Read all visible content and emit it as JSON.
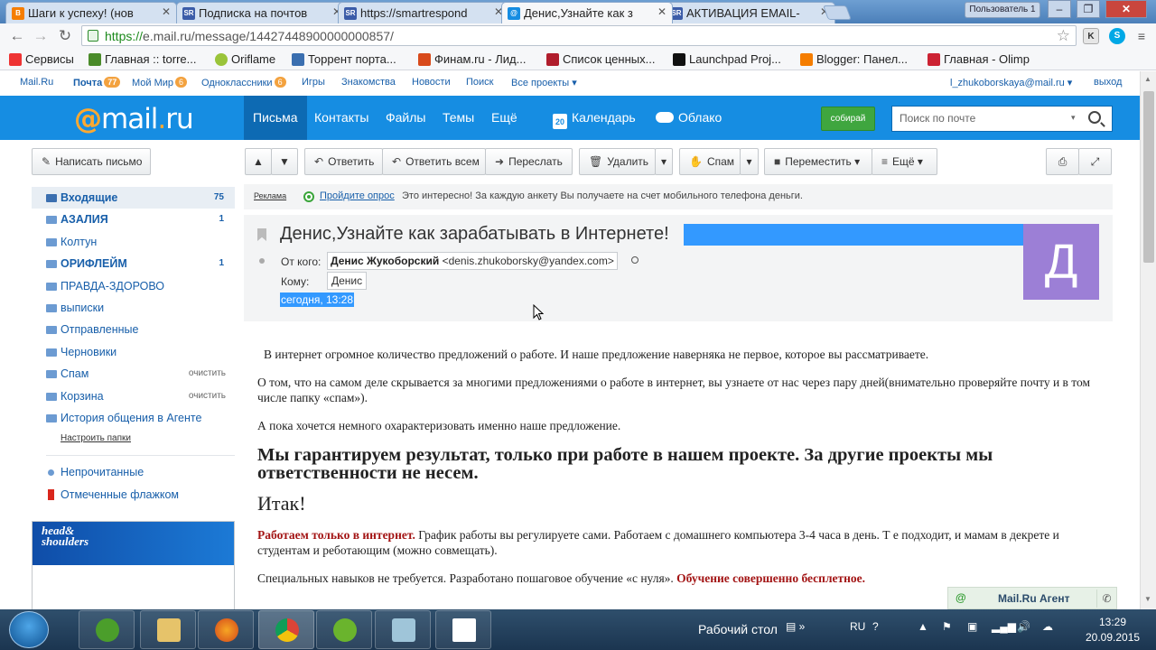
{
  "browser": {
    "tabs": [
      {
        "title": "Шаги к успеху! (нов",
        "favicon": "Blogger",
        "favicon_color": "#f57d00"
      },
      {
        "title": "Подписка на почтов",
        "favicon": "SR",
        "favicon_color": "#3b5ca8"
      },
      {
        "title": "https://smartrespond",
        "favicon": "SR",
        "favicon_color": "#3b5ca8"
      },
      {
        "title": "Денис,Узнайте как з",
        "favicon": "mail",
        "favicon_color": "#168de2"
      },
      {
        "title": "АКТИВАЦИЯ EMAIL-",
        "favicon": "SR",
        "favicon_color": "#3b5ca8"
      }
    ],
    "user_badge": "Пользователь 1",
    "url_secure": "https://",
    "url_rest": "e.mail.ru/message/14427448900000000857/",
    "bookmarks": [
      {
        "label": "Сервисы",
        "color": "#e33"
      },
      {
        "label": "Главная :: torre...",
        "color": "#4a8b2a"
      },
      {
        "label": "Oriflame",
        "color": "#9ac43a"
      },
      {
        "label": "Торрент порта...",
        "color": "#3b6fb0"
      },
      {
        "label": "Финам.ru - Лид...",
        "color": "#d84a1b"
      },
      {
        "label": "Список ценных...",
        "color": "#b01d2c"
      },
      {
        "label": "Launchpad Proj...",
        "color": "#111"
      },
      {
        "label": "Blogger: Панел...",
        "color": "#f57d00"
      },
      {
        "label": "Главная - Olimp",
        "color": "#c23"
      }
    ]
  },
  "portal": {
    "links": [
      "Mail.Ru",
      "Почта",
      "Мой Мир",
      "Одноклассники",
      "Игры",
      "Знакомства",
      "Новости",
      "Поиск",
      "Все проекты"
    ],
    "badges": {
      "mail": "77",
      "mymir": "6",
      "ok": "6"
    },
    "user": "l_zhukoborskaya@mail.ru",
    "logout": "выход"
  },
  "header": {
    "logo_at": "@",
    "logo_mail": "mail",
    "logo_dot": ".",
    "logo_ru": "ru",
    "nav": [
      "Письма",
      "Контакты",
      "Файлы",
      "Темы",
      "Ещё"
    ],
    "calendar": "Календарь",
    "calendar_day": "20",
    "cloud": "Облако",
    "collect": "собирай",
    "search_placeholder": "Поиск по почте"
  },
  "toolbar": {
    "compose": "Написать письмо",
    "reply": "Ответить",
    "reply_all": "Ответить всем",
    "forward": "Переслать",
    "delete": "Удалить",
    "spam": "Спам",
    "move": "Переместить",
    "more": "Ещё"
  },
  "sidebar": {
    "folders": [
      {
        "label": "Входящие",
        "count": "75"
      },
      {
        "label": "АЗАЛИЯ",
        "count": "1"
      },
      {
        "label": "Колтун",
        "count": ""
      },
      {
        "label": "ОРИФЛЕЙМ",
        "count": "1"
      },
      {
        "label": "ПРАВДА-ЗДОРОВО",
        "count": ""
      },
      {
        "label": "выписки",
        "count": ""
      },
      {
        "label": "Отправленные",
        "count": ""
      },
      {
        "label": "Черновики",
        "count": ""
      },
      {
        "label": "Спам",
        "action": "очистить"
      },
      {
        "label": "Корзина",
        "action": "очистить"
      },
      {
        "label": "История общения в Агенте",
        "count": ""
      }
    ],
    "configure": "Настроить папки",
    "unread": "Непрочитанные",
    "flagged": "Отмеченные флажком",
    "ad_brand_1": "head&",
    "ad_brand_2": "shoulders"
  },
  "adline": {
    "label": "Реклама",
    "link": "Пройдите опрос",
    "text": "Это интересно! За каждую анкету Вы получаете на счет мобильного телефона деньги."
  },
  "message": {
    "subject": "Денис,Узнайте как зарабатывать в Интернете!",
    "from_label": "От кого:",
    "from_name": "Денис Жукоборский",
    "from_email": "<denis.zhukoborsky@yandex.com>",
    "to_label": "Кому:",
    "to_name": "Денис",
    "date": "сегодня, 13:28",
    "avatar_letter": "Д",
    "body": {
      "p1": "В интернет огромное количество предложений о работе. И наше предложение наверняка не первое, которое вы рассматриваете.",
      "p2": "О том, что на самом деле скрывается за многими предложениями о работе в интернет, вы узнаете от нас через пару дней(внимательно проверяйте почту и в том числе папку «спам»).",
      "p3": "А пока хочется немного охарактеризовать именно наше предложение.",
      "h1": "Мы гарантируем результат, только при работе в нашем проекте. За другие проекты мы ответственности не несем.",
      "itak": "Итак!",
      "p4_red": "Работаем только в интернет.",
      "p4": " График работы вы регулируете сами. Работаем с домашнего компьютера 3-4 часа в день. Т е подходит, и мамам в декрете и студентам и реботающим (можно совмещать).",
      "p5": "Специальных навыков не требуется. Разработано пошаговое обучение «с нуля». ",
      "p5_red": "Обучение совершенно бесплетное."
    }
  },
  "agent": {
    "label": "Mail.Ru Агент",
    "at": "@"
  },
  "taskbar": {
    "desktop": "Рабочий стол",
    "lang": "RU",
    "time": "13:29",
    "date": "20.09.2015"
  }
}
